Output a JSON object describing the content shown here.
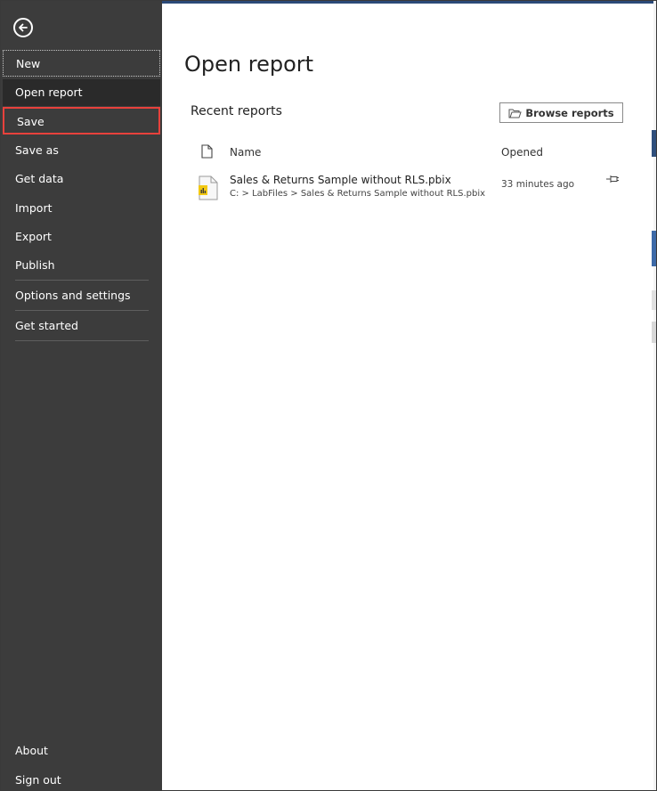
{
  "sidebar": {
    "items": [
      {
        "label": "New"
      },
      {
        "label": "Open report"
      },
      {
        "label": "Save"
      },
      {
        "label": "Save as"
      },
      {
        "label": "Get data"
      },
      {
        "label": "Import"
      },
      {
        "label": "Export"
      },
      {
        "label": "Publish"
      },
      {
        "label": "Options and settings"
      },
      {
        "label": "Get started"
      }
    ],
    "bottom": [
      {
        "label": "About"
      },
      {
        "label": "Sign out"
      }
    ]
  },
  "main": {
    "title": "Open report",
    "section_title": "Recent reports",
    "browse_label": "Browse reports",
    "columns": {
      "name": "Name",
      "opened": "Opened"
    },
    "files": [
      {
        "name": "Sales & Returns Sample without RLS.pbix",
        "path": "C: > LabFiles > Sales & Returns Sample without RLS.pbix",
        "opened": "33 minutes ago"
      }
    ]
  },
  "colors": {
    "sidebar_bg": "#3c3c3c",
    "highlight": "#e8413c",
    "accent": "#f2c811"
  },
  "icons": [
    "back-arrow-icon",
    "file-icon",
    "pbix-file-icon",
    "folder-icon",
    "pin-icon"
  ]
}
